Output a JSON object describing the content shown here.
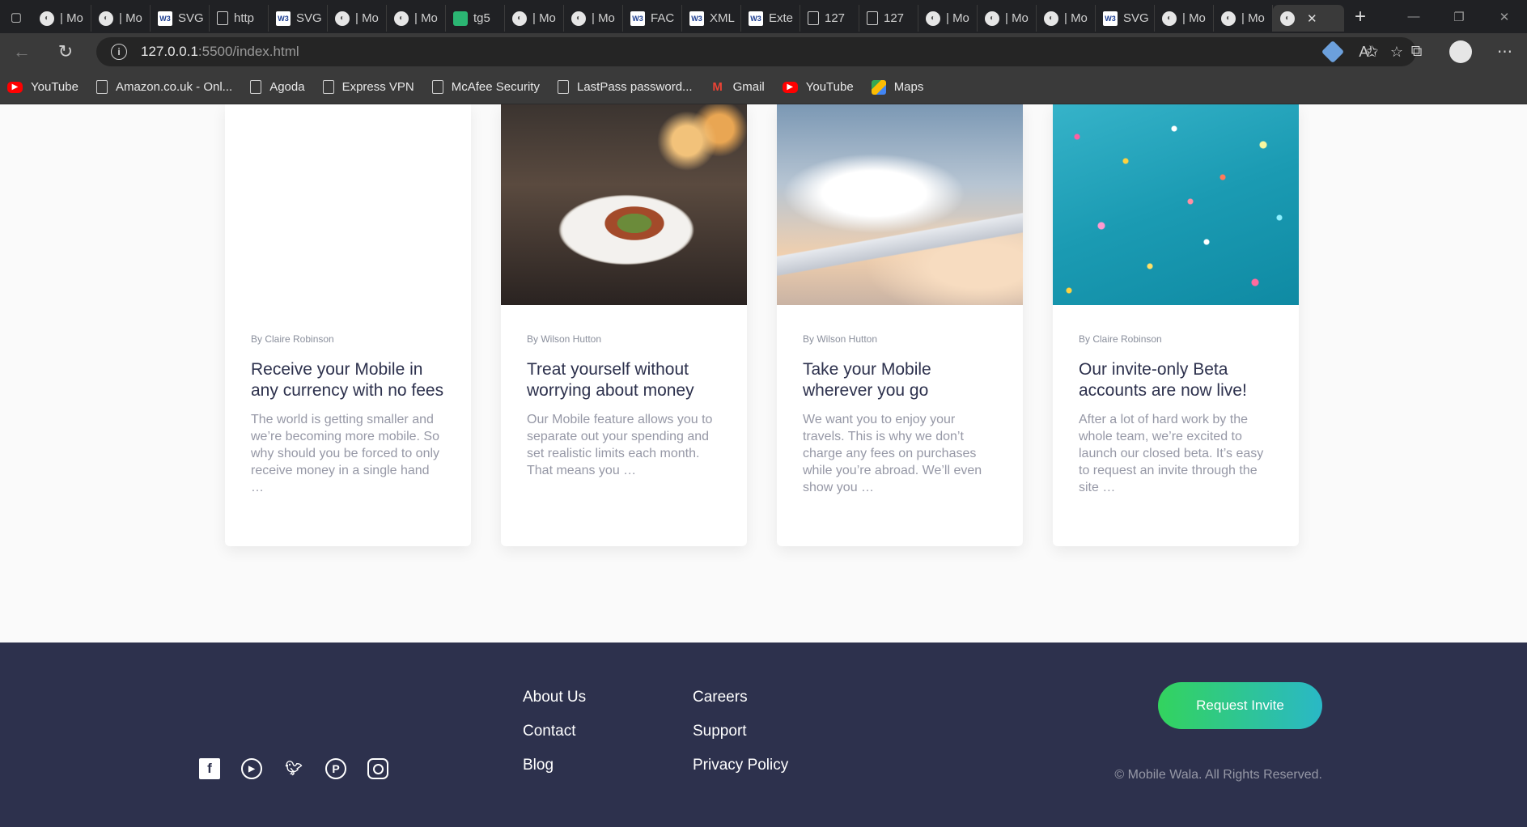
{
  "browser": {
    "tabs": [
      {
        "icon": "globe",
        "label": "| Mo"
      },
      {
        "icon": "globe",
        "label": "| Mo"
      },
      {
        "icon": "w3",
        "label": "SVG"
      },
      {
        "icon": "doc",
        "label": "http"
      },
      {
        "icon": "w3",
        "label": "SVG"
      },
      {
        "icon": "globe",
        "label": "| Mo"
      },
      {
        "icon": "globe",
        "label": "| Mo"
      },
      {
        "icon": "green",
        "label": "tg5"
      },
      {
        "icon": "globe",
        "label": "| Mo"
      },
      {
        "icon": "globe",
        "label": "| Mo"
      },
      {
        "icon": "w3",
        "label": "FAC"
      },
      {
        "icon": "w3",
        "label": "XML"
      },
      {
        "icon": "w3",
        "label": "Exte"
      },
      {
        "icon": "doc",
        "label": "127"
      },
      {
        "icon": "doc",
        "label": "127"
      },
      {
        "icon": "globe",
        "label": "| Mo"
      },
      {
        "icon": "globe",
        "label": "| Mo"
      },
      {
        "icon": "globe",
        "label": "| Mo"
      },
      {
        "icon": "w3",
        "label": "SVG"
      },
      {
        "icon": "globe",
        "label": "| Mo"
      },
      {
        "icon": "globe",
        "label": "| Mo"
      }
    ],
    "url_host": "127.0.0.1",
    "url_rest": ":5500/index.html",
    "bookmarks": [
      {
        "icon": "yt",
        "label": "YouTube"
      },
      {
        "icon": "doc",
        "label": "Amazon.co.uk - Onl..."
      },
      {
        "icon": "doc",
        "label": "Agoda"
      },
      {
        "icon": "doc",
        "label": "Express VPN"
      },
      {
        "icon": "doc",
        "label": "McAfee Security"
      },
      {
        "icon": "doc",
        "label": "LastPass password..."
      },
      {
        "icon": "gmail",
        "label": "Gmail"
      },
      {
        "icon": "yt",
        "label": "YouTube"
      },
      {
        "icon": "maps",
        "label": "Maps"
      }
    ]
  },
  "articles": [
    {
      "image": "",
      "author": "By Claire Robinson",
      "title": "Receive your Mobile in any currency with no fees",
      "excerpt": "The world is getting smaller and we’re becoming more mobile. So why should you be forced to only receive money in a single hand …"
    },
    {
      "image": "restaurant-plate-photo",
      "author": "By Wilson Hutton",
      "title": "Treat yourself without worrying about money",
      "excerpt": "Our Mobile feature allows you to separate out your spending and set realistic limits each month. That means you …"
    },
    {
      "image": "airplane-wing-photo",
      "author": "By Wilson Hutton",
      "title": "Take your Mobile wherever you go",
      "excerpt": "We want you to enjoy your travels. This is why we don’t charge any fees on purchases while you’re abroad. We’ll even show you …"
    },
    {
      "image": "confetti-photo",
      "author": "By Claire Robinson",
      "title": "Our invite-only Beta accounts are now live!",
      "excerpt": "After a lot of hard work by the whole team, we’re excited to launch our closed beta. It’s easy to request an invite through the site …"
    }
  ],
  "footer": {
    "links_col1": [
      "About Us",
      "Contact",
      "Blog"
    ],
    "links_col2": [
      "Careers",
      "Support",
      "Privacy Policy"
    ],
    "cta_label": "Request Invite",
    "copyright": "© Mobile Wala. All Rights Reserved.",
    "social_icons": [
      "facebook-icon",
      "youtube-icon",
      "twitter-icon",
      "pinterest-icon",
      "instagram-icon"
    ],
    "colors": {
      "bg": "#2d314d",
      "cta_start": "#33d35e",
      "cta_end": "#2ab8c6"
    }
  }
}
